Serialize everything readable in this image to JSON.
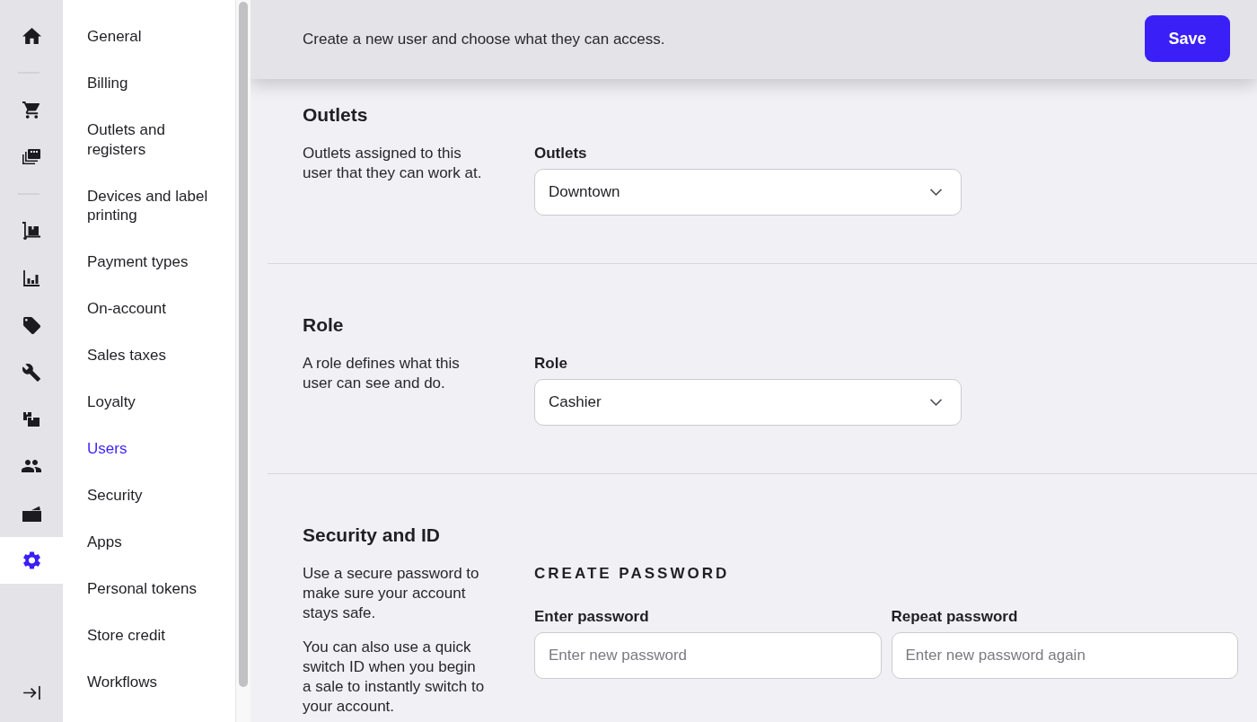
{
  "nav_rail": {
    "groups": [
      {
        "items": [
          {
            "selected": false
          }
        ]
      },
      {
        "items": [
          {
            "selected": false
          },
          {
            "selected": false
          }
        ]
      },
      {
        "items": [
          {
            "selected": false
          },
          {
            "selected": false
          },
          {
            "selected": false
          },
          {
            "selected": false
          },
          {
            "selected": false
          },
          {
            "selected": false
          },
          {
            "selected": false
          },
          {
            "selected": true
          }
        ]
      }
    ]
  },
  "settings_menu": {
    "items": [
      {
        "label": "General",
        "selected": false
      },
      {
        "label": "Billing",
        "selected": false
      },
      {
        "label": "Outlets and registers",
        "selected": false
      },
      {
        "label": "Devices and label printing",
        "selected": false
      },
      {
        "label": "Payment types",
        "selected": false
      },
      {
        "label": "On-account",
        "selected": false
      },
      {
        "label": "Sales taxes",
        "selected": false
      },
      {
        "label": "Loyalty",
        "selected": false
      },
      {
        "label": "Users",
        "selected": true
      },
      {
        "label": "Security",
        "selected": false
      },
      {
        "label": "Apps",
        "selected": false
      },
      {
        "label": "Personal tokens",
        "selected": false
      },
      {
        "label": "Store credit",
        "selected": false
      },
      {
        "label": "Workflows",
        "selected": false
      }
    ]
  },
  "header": {
    "description": "Create a new user and choose what they can access.",
    "save_button": "Save"
  },
  "sections": [
    {
      "title": "Outlets",
      "paragraphs": [
        "Outlets assigned to this user that they can work at."
      ],
      "fields": [
        {
          "kind": "select",
          "label": "Outlets",
          "value": "Downtown"
        }
      ]
    },
    {
      "title": "Role",
      "paragraphs": [
        "A role defines what this user can see and do."
      ],
      "fields": [
        {
          "kind": "select",
          "label": "Role",
          "value": "Cashier"
        }
      ]
    },
    {
      "title": "Security and ID",
      "paragraphs": [
        "Use a secure password to make sure your account stays safe.",
        "You can also use a quick switch ID when you begin a sale to instantly switch to your account."
      ],
      "subheading": "CREATE PASSWORD",
      "fields": [
        {
          "kind": "password",
          "label": "Enter password",
          "placeholder": "Enter new password"
        },
        {
          "kind": "password",
          "label": "Repeat password",
          "placeholder": "Enter new password again"
        }
      ]
    }
  ]
}
